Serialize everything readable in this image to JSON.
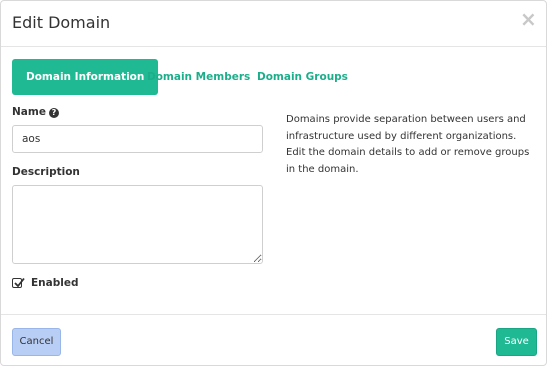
{
  "modal": {
    "title": "Edit Domain",
    "close_glyph": "×"
  },
  "tabs": [
    {
      "label": "Domain Information",
      "active": true
    },
    {
      "label": "Domain Members",
      "active": false
    },
    {
      "label": "Domain Groups",
      "active": false
    }
  ],
  "form": {
    "name_label": "Name",
    "name_value": "aos",
    "description_label": "Description",
    "description_value": "",
    "enabled_label": "Enabled",
    "enabled_checked": true
  },
  "help": {
    "text": "Domains provide separation between users and infrastructure used by different organizations. Edit the domain details to add or remove groups in the domain."
  },
  "footer": {
    "cancel_label": "Cancel",
    "save_label": "Save"
  },
  "colors": {
    "accent": "#1fb993",
    "cancel_bg": "#b8cef5"
  },
  "icons": {
    "close": "close-icon",
    "help": "question-circle-icon",
    "check": "check-icon"
  }
}
